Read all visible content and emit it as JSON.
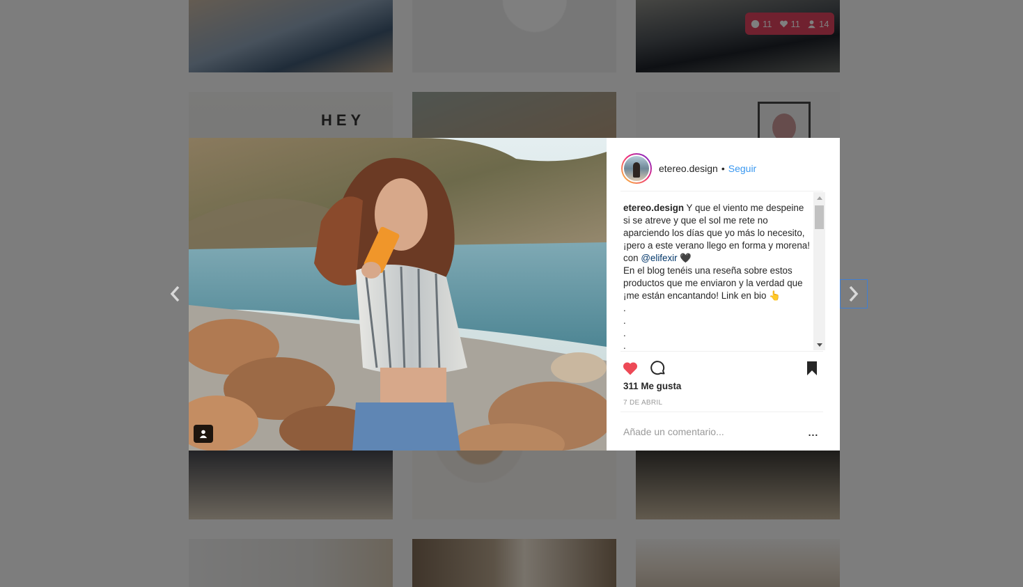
{
  "feed": {
    "stats_badge": {
      "comments": "11",
      "likes": "11",
      "followers": "14"
    },
    "tile_text": "HEY"
  },
  "post": {
    "username": "etereo.design",
    "separator": "•",
    "follow_label": "Seguir",
    "caption": {
      "author": "etereo.design",
      "text_1": " Y que el viento me despeine si se atreve y que el sol me rete no aparciendo los días que yo más lo necesito, ¡pero a este verano llego en forma y morena! con ",
      "mention": "@elifexir",
      "text_2": " 🖤",
      "text_3": "En el blog tenéis una reseña sobre estos productos que me enviaron y la verdad que ¡me están encantando! Link en bio 👆",
      "dots": [
        ".",
        ".",
        ".",
        "."
      ]
    },
    "likes_label": "311 Me gusta",
    "date": "7 DE ABRIL",
    "comment_placeholder": "Añade un comentario...",
    "more_label": "...",
    "liked": true
  },
  "colors": {
    "like_red": "#ed4956",
    "link_blue": "#3897f0",
    "mention_blue": "#003569",
    "badge_pink": "#e0435e"
  }
}
